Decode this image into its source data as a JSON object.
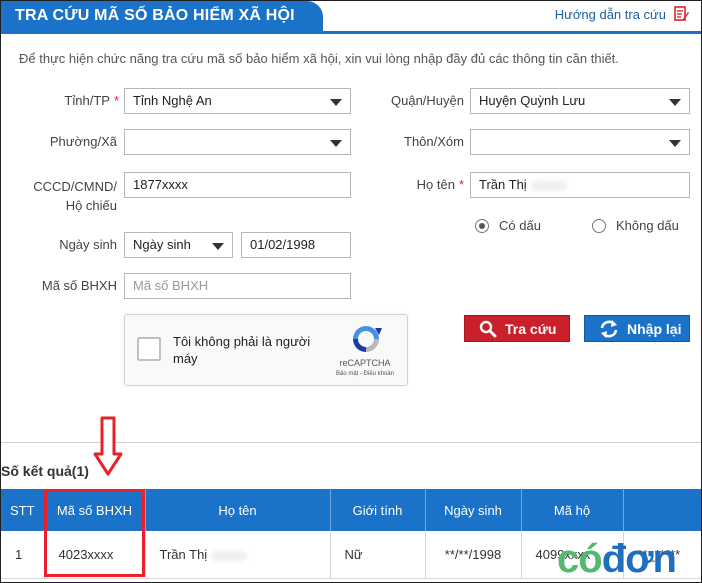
{
  "header": {
    "title": "TRA CỨU MÃ SỐ BẢO HIỂM XÃ HỘI",
    "help_link": "Hướng dẫn tra cứu"
  },
  "intro": "Để thực hiện chức năng tra cứu mã số bảo hiểm xã hội, xin vui lòng nhập đầy đủ các thông tin cần thiết.",
  "form": {
    "province_label": "Tỉnh/TP",
    "province_value": "Tỉnh Nghệ An",
    "district_label": "Quận/Huyện",
    "district_value": "Huyện Quỳnh Lưu",
    "ward_label": "Phường/Xã",
    "ward_value": "",
    "village_label": "Thôn/Xóm",
    "village_value": "",
    "id_label_line1": "CCCD/CMND/",
    "id_label_line2": "Hộ chiếu",
    "id_value": "1877xxxx",
    "name_label": "Họ tên",
    "name_value": "Trần Thị",
    "required_mark": "*",
    "radio_accent": "Có dấu",
    "radio_no_accent": "Không dấu",
    "dob_label": "Ngày sinh",
    "dob_type": "Ngày sinh",
    "dob_value": "01/02/1998",
    "bhxh_label": "Mã số BHXH",
    "bhxh_placeholder": "Mã số BHXH"
  },
  "captcha": {
    "text": "Tôi không phải là người máy",
    "brand": "reCAPTCHA",
    "terms": "Bảo mật - Điều khoản"
  },
  "buttons": {
    "search": "Tra cứu",
    "reset": "Nhập lại"
  },
  "results": {
    "count_label": "Số kết quả(1)",
    "columns": [
      "STT",
      "Mã số BHXH",
      "Họ tên",
      "Giới tính",
      "Ngày sinh",
      "Mã hộ"
    ],
    "row": {
      "stt": "1",
      "bhxh": "4023xxxx",
      "name": "Trần Thị",
      "gender": "Nữ",
      "dob": "**/**/1998",
      "household": "4099xxxx",
      "extra": "**_*****"
    }
  },
  "watermark": {
    "part1": "có",
    "part2": "đơn"
  },
  "colors": {
    "primary_blue": "#1a73c9",
    "search_red": "#c9202a",
    "highlight_red": "#e8212b"
  }
}
